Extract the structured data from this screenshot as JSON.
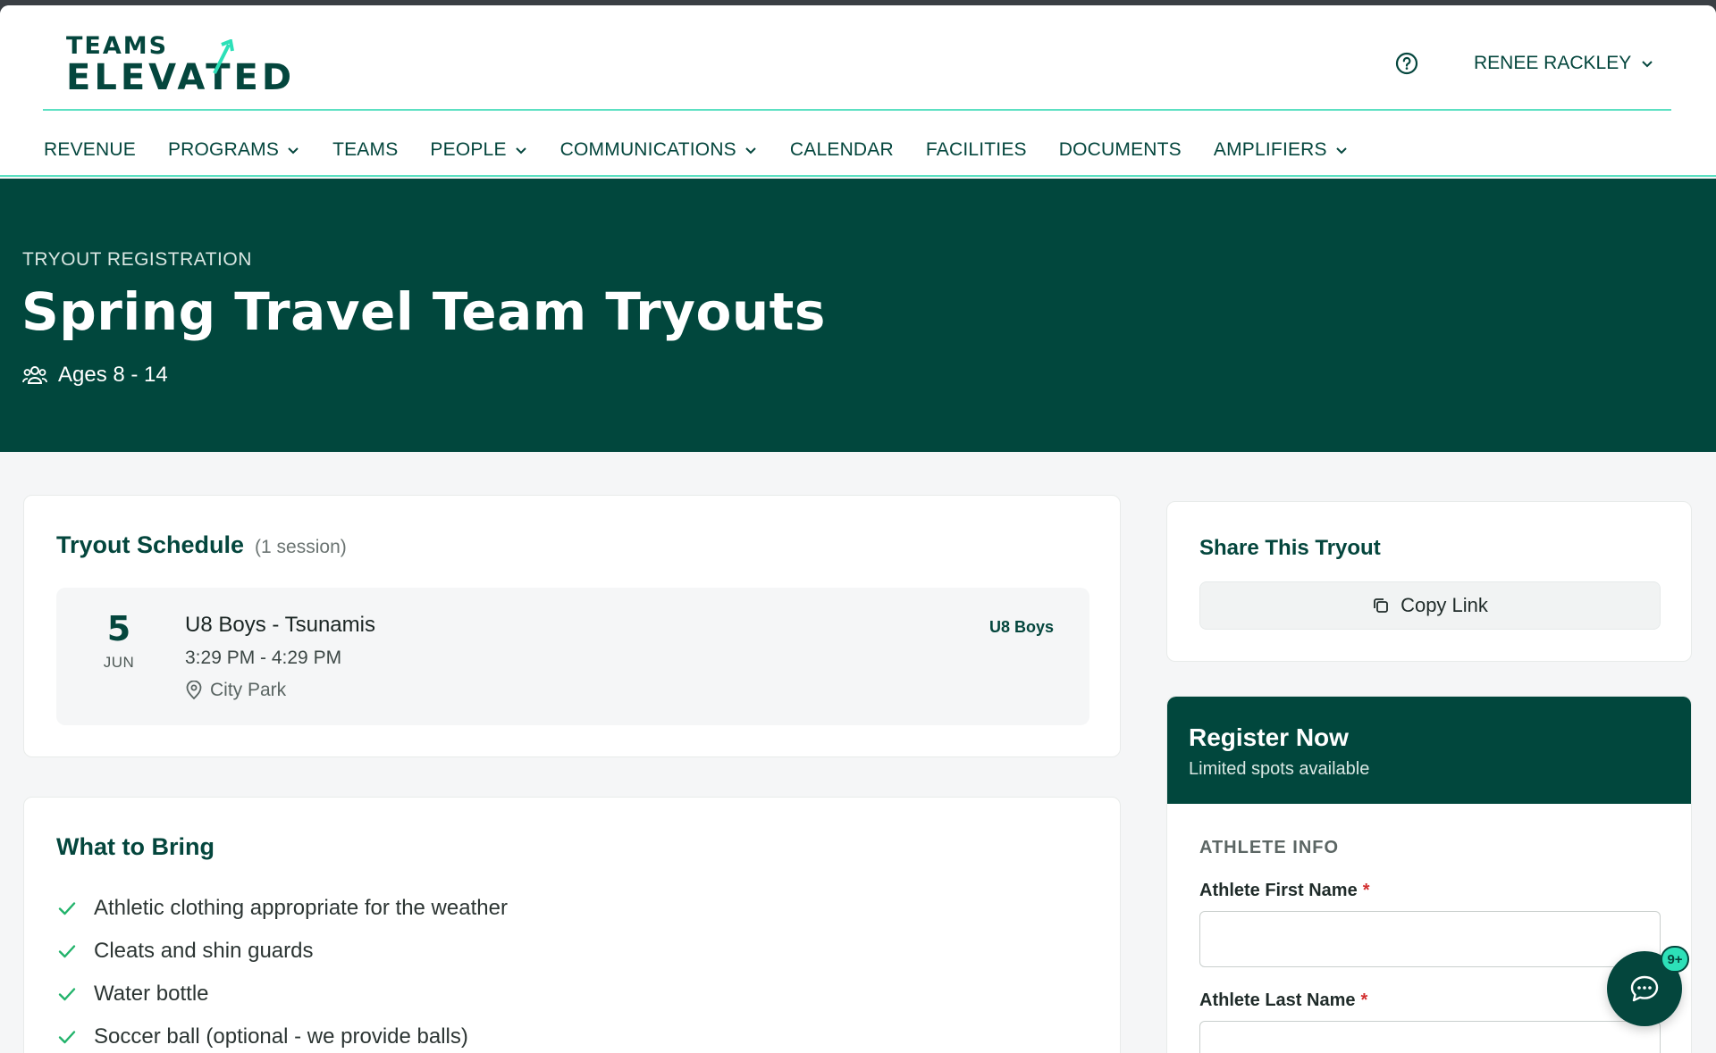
{
  "brand": {
    "logo_top": "TEAMS",
    "logo_bottom": "ELEVATED",
    "accent": "#5ce0c2",
    "primary": "#01473d"
  },
  "header": {
    "help_icon": "help-circle-icon",
    "user_name": "RENEE RACKLEY"
  },
  "nav": {
    "items": [
      {
        "label": "REVENUE",
        "dropdown": false
      },
      {
        "label": "PROGRAMS",
        "dropdown": true
      },
      {
        "label": "TEAMS",
        "dropdown": false
      },
      {
        "label": "PEOPLE",
        "dropdown": true
      },
      {
        "label": "COMMUNICATIONS",
        "dropdown": true
      },
      {
        "label": "CALENDAR",
        "dropdown": false
      },
      {
        "label": "FACILITIES",
        "dropdown": false
      },
      {
        "label": "DOCUMENTS",
        "dropdown": false
      },
      {
        "label": "AMPLIFIERS",
        "dropdown": true
      }
    ]
  },
  "hero": {
    "eyebrow": "TRYOUT REGISTRATION",
    "title": "Spring Travel Team Tryouts",
    "ages": "Ages 8 - 14"
  },
  "schedule": {
    "title": "Tryout Schedule",
    "count": "(1 session)",
    "sessions": [
      {
        "day": "5",
        "month": "JUN",
        "name": "U8 Boys - Tsunamis",
        "time": "3:29 PM - 4:29 PM",
        "location": "City Park",
        "tag": "U8 Boys"
      }
    ]
  },
  "bring": {
    "title": "What to Bring",
    "items": [
      "Athletic clothing appropriate for the weather",
      "Cleats and shin guards",
      "Water bottle",
      "Soccer ball (optional - we provide balls)"
    ]
  },
  "share": {
    "title": "Share This Tryout",
    "copy_label": "Copy Link"
  },
  "register": {
    "title": "Register Now",
    "subtitle": "Limited spots available",
    "section": "ATHLETE INFO",
    "first_name_label": "Athlete First Name",
    "last_name_label": "Athlete Last Name",
    "required_mark": "*",
    "first_name_value": "",
    "last_name_value": ""
  },
  "chat": {
    "badge": "9+"
  }
}
